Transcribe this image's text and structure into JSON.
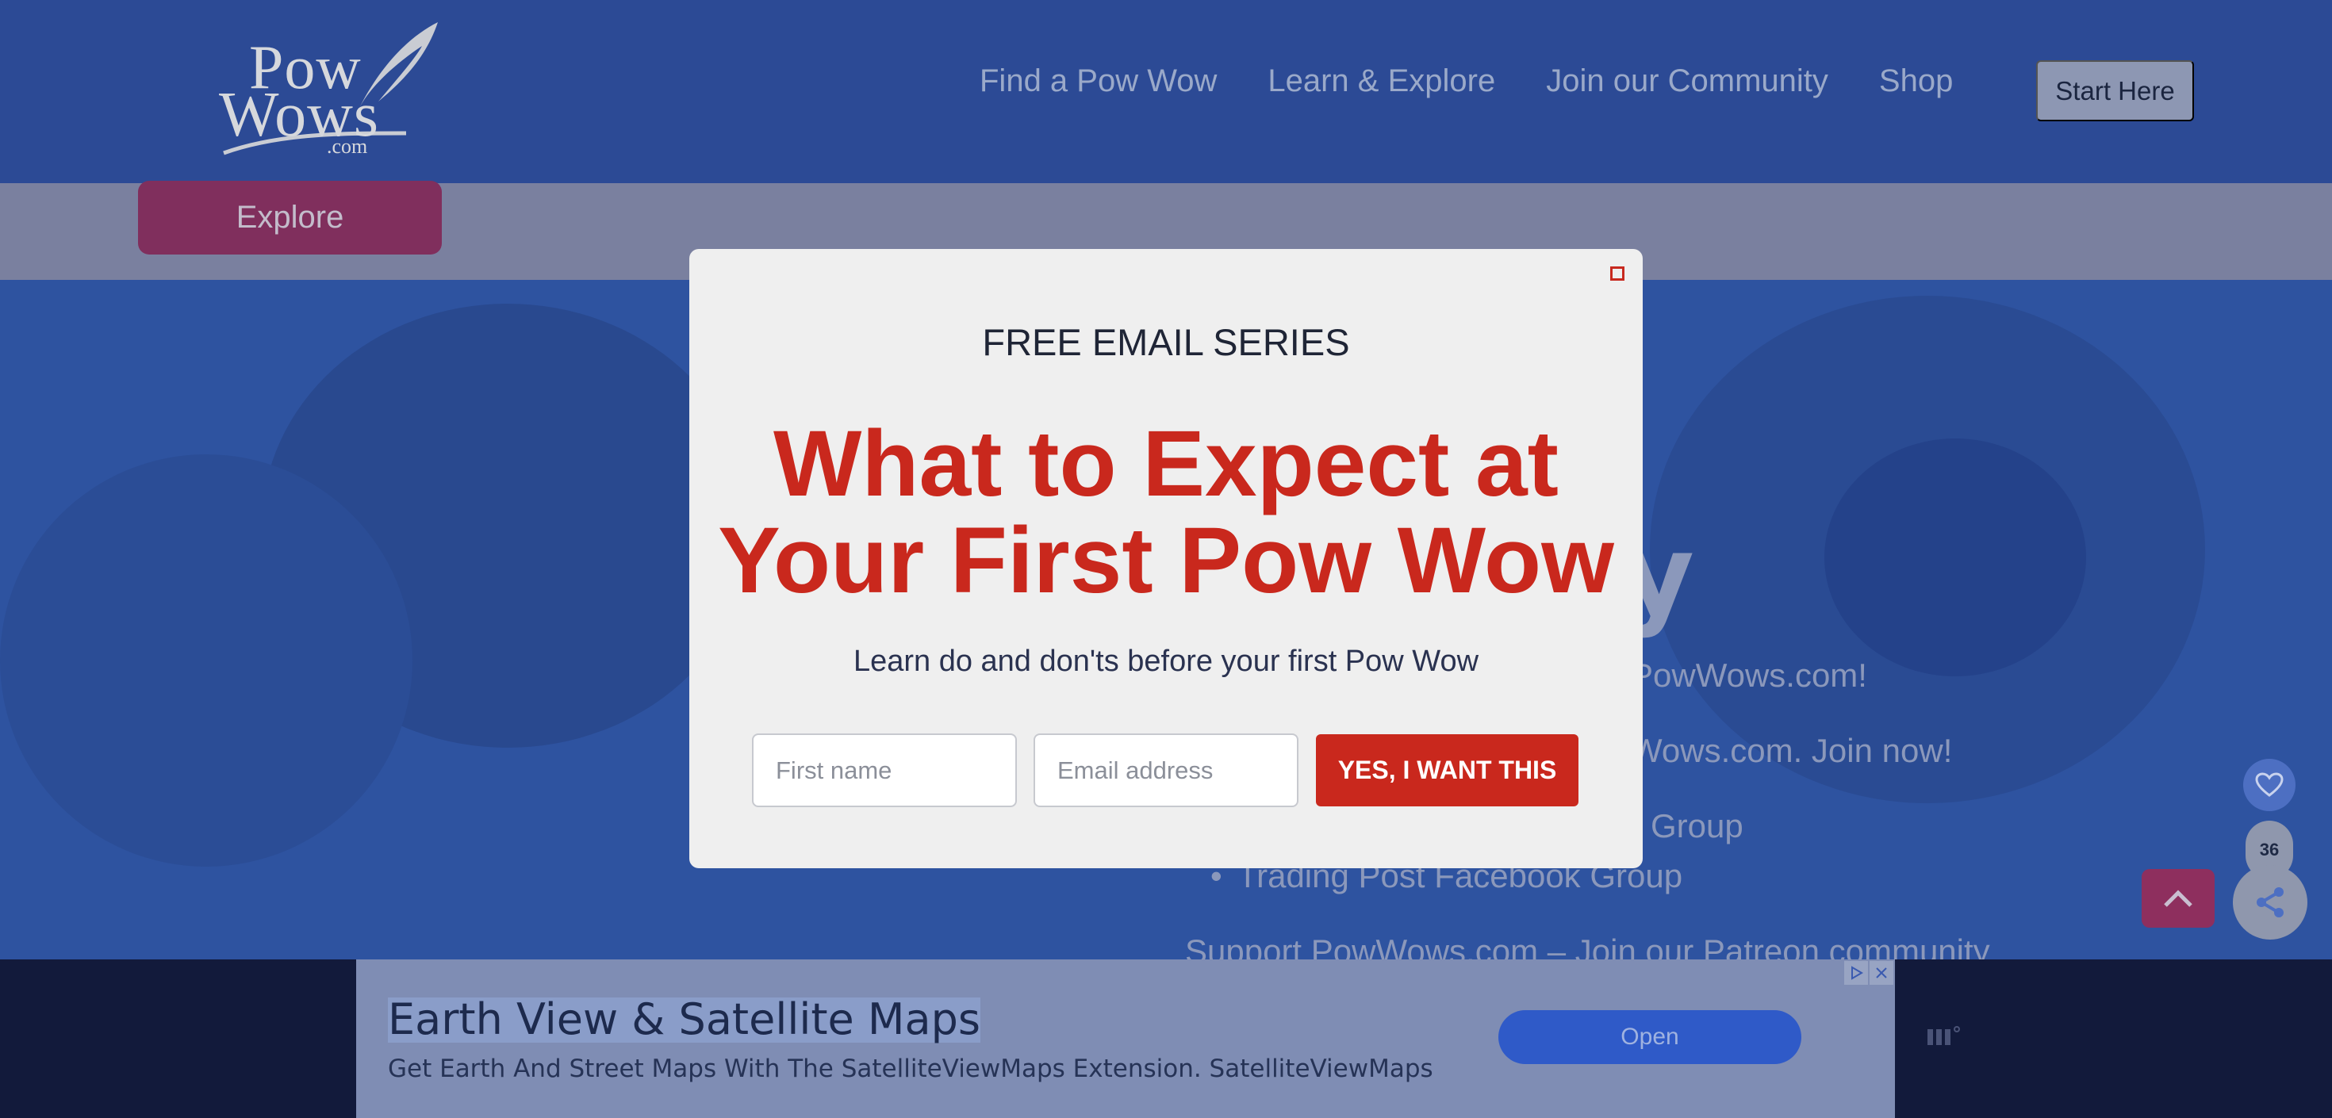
{
  "logo": {
    "line1": "Pow",
    "line2": "Wows",
    "line3": ".com"
  },
  "nav": {
    "items": [
      {
        "label": "Find a Pow Wow"
      },
      {
        "label": "Learn & Explore"
      },
      {
        "label": "Join our Community"
      },
      {
        "label": "Shop"
      }
    ],
    "cta_label": "Start Here"
  },
  "subbar": {
    "explore_label": "Explore"
  },
  "hero": {
    "heading_fragment": "ity",
    "line1": "PowWows.com!",
    "line2": "Wows.com.  Join now!",
    "line3": "Group",
    "bullet": "Trading Post Facebook Group",
    "support": "Support PowWows.com – Join our Patreon community"
  },
  "widgets": {
    "like_count": "36"
  },
  "modal": {
    "eyebrow": "FREE EMAIL SERIES",
    "headline_line1": "What to Expect at",
    "headline_line2": "Your First Pow Wow",
    "subtitle": "Learn do and don'ts before your first Pow Wow",
    "first_name_placeholder": "First name",
    "email_placeholder": "Email address",
    "submit_label": "YES, I WANT THIS"
  },
  "ad": {
    "title": "Earth View & Satellite Maps",
    "description": "Get Earth And Street Maps With The SatelliteViewMaps Extension. SatelliteViewMaps",
    "button_label": "Open"
  },
  "colors": {
    "header_bg": "#2c4a95",
    "modal_accent": "#c9281d",
    "explore_button": "#802f5d",
    "ad_button": "#2f5ac8"
  },
  "icons": [
    "logo-feather-icon",
    "close-icon",
    "heart-icon",
    "share-icon",
    "chevron-up-icon",
    "adchoices-icon",
    "ad-close-icon",
    "ad-brand-icon"
  ]
}
